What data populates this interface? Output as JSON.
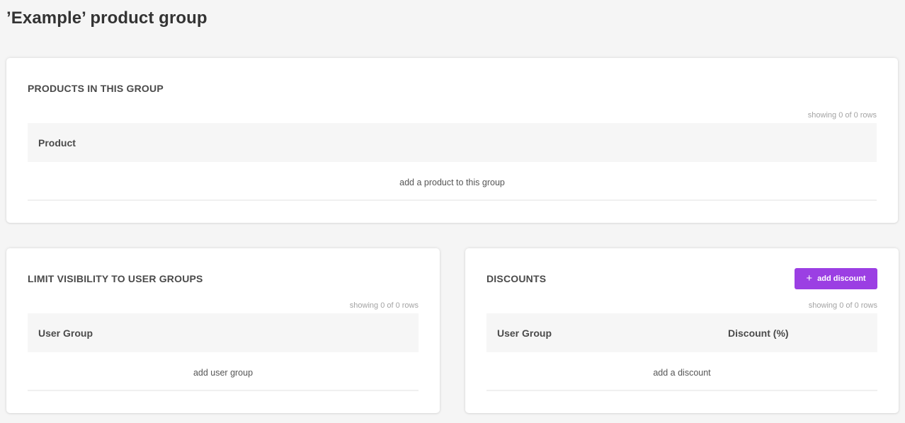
{
  "page": {
    "title": "’Example’ product group"
  },
  "products_card": {
    "title": "PRODUCTS IN THIS GROUP",
    "rows_count": "showing 0 of 0 rows",
    "columns": [
      "Product"
    ],
    "empty_text": "add a product to this group"
  },
  "visibility_card": {
    "title": "LIMIT VISIBILITY TO USER GROUPS",
    "rows_count": "showing 0 of 0 rows",
    "columns": [
      "User Group"
    ],
    "empty_text": "add user group"
  },
  "discounts_card": {
    "title": "DISCOUNTS",
    "add_button_label": "add discount",
    "add_button_icon": "plus-icon",
    "rows_count": "showing 0 of 0 rows",
    "columns": [
      "User Group",
      "Discount (%)"
    ],
    "empty_text": "add a discount"
  },
  "colors": {
    "accent": "#9b3fe3",
    "background": "#f5f5f5",
    "card": "#ffffff",
    "table_header": "#f6f6f6"
  }
}
